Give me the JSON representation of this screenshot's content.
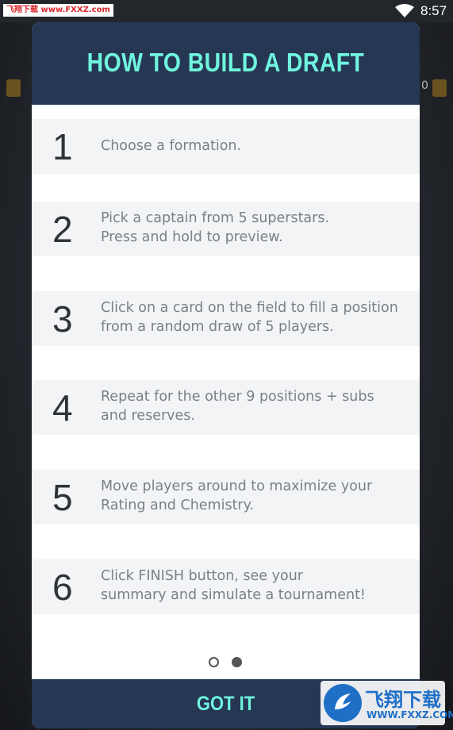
{
  "status_bar": {
    "watermark": "飞翔下载 www.FXXZ.com",
    "time": "8:57"
  },
  "background": {
    "right_chip_text": "0"
  },
  "modal": {
    "title": "HOW TO BUILD A DRAFT",
    "steps": [
      {
        "number": "1",
        "text": "Choose a formation."
      },
      {
        "number": "2",
        "text": "Pick a captain from 5 superstars.\nPress and hold to preview."
      },
      {
        "number": "3",
        "text": "Click on a card on the field to fill a position\nfrom a random draw of 5 players."
      },
      {
        "number": "4",
        "text": "Repeat for the other 9 positions + subs\nand reserves."
      },
      {
        "number": "5",
        "text": "Move players around to maximize your\nRating and Chemistry."
      },
      {
        "number": "6",
        "text": "Click FINISH button, see your\nsummary and simulate a tournament!"
      }
    ],
    "pager": {
      "pages": 2,
      "current": 2
    },
    "button_label": "GOT IT"
  },
  "logo": {
    "name": "飞翔下载",
    "url": "WWW.FXXZ.COM"
  },
  "colors": {
    "header_bg": "#263754",
    "accent": "#6ff5de",
    "step_bg": "#f3f4f6"
  }
}
